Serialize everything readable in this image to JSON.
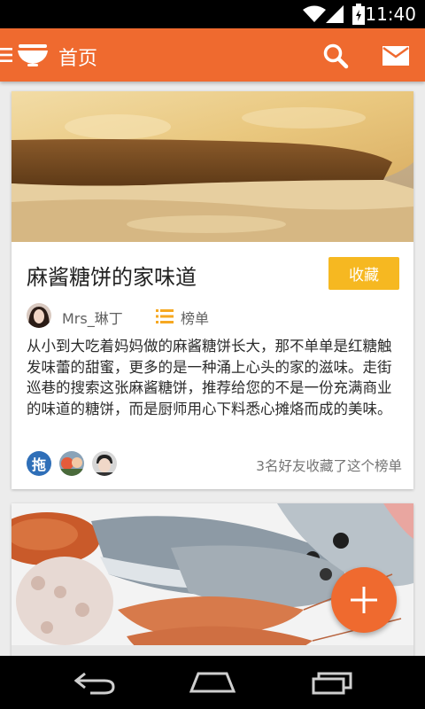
{
  "status_bar": {
    "time": "11:40"
  },
  "app_bar": {
    "title": "首页"
  },
  "feed": [
    {
      "title": "麻酱糖饼的家味道",
      "collect_label": "收藏",
      "author": "Mrs_琳丁",
      "list_label": "榜单",
      "description": "从小到大吃着妈妈做的麻酱糖饼长大，那不单单是红糖触发味蕾的甜蜜，更多的是一种涌上心头的家的滋味。走街巡巷的搜索这张麻酱糖饼，推荐给您的不是一份充满商业的味道的糖饼，而是厨师用心下料悉心摊烙而成的美味。",
      "friend_avatar_1_text": "拖",
      "friends_text": "3名好友收藏了这个榜单"
    },
    {
      "image": "seafood-photo"
    }
  ],
  "colors": {
    "primary": "#ef6a2f",
    "accent": "#f6b821",
    "list_icon": "#f6a821"
  },
  "icons": {
    "menu": "menu-icon",
    "logo": "bowl-icon",
    "search": "search-icon",
    "mail": "mail-icon",
    "list": "list-icon",
    "fab": "add-icon",
    "back": "back-icon",
    "home": "home-icon",
    "recents": "recents-icon"
  }
}
